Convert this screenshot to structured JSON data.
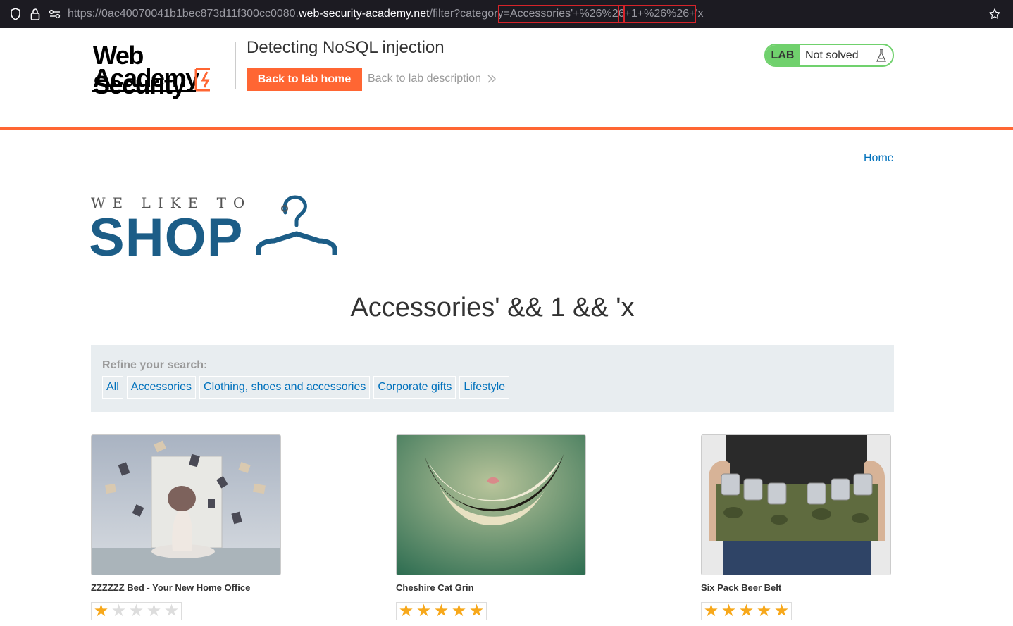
{
  "browser": {
    "url_prefix": "https://0ac40070041b1bec873d11f300cc0080.",
    "url_host": "web-security-academy.net",
    "url_path": "/filter?category=Accessories'+%26%26+1+%26%26+'x"
  },
  "header": {
    "logo_line1": "Web Security",
    "logo_line2": "Academy",
    "lab_title": "Detecting NoSQL injection",
    "back_button": "Back to lab home",
    "description_link": "Back to lab description",
    "status_tag": "LAB",
    "status_text": "Not solved"
  },
  "nav": {
    "home": "Home"
  },
  "shop_logo": {
    "top_text": "WE LIKE TO",
    "main_text": "SHOP"
  },
  "category_heading": "Accessories' && 1 && 'x",
  "refine": {
    "label": "Refine your search:",
    "filters": [
      "All",
      "Accessories",
      "Clothing, shoes and accessories",
      "Corporate gifts",
      "Lifestyle"
    ]
  },
  "products": [
    {
      "name": "ZZZZZZ Bed - Your New Home Office",
      "rating": 1
    },
    {
      "name": "Cheshire Cat Grin",
      "rating": 5
    },
    {
      "name": "Six Pack Beer Belt",
      "rating": 5
    }
  ],
  "colors": {
    "accent": "#ff6633",
    "link": "#0071bc",
    "status_green": "#70d16d",
    "shop_blue": "#1c5d87",
    "star": "#f7a81b"
  }
}
